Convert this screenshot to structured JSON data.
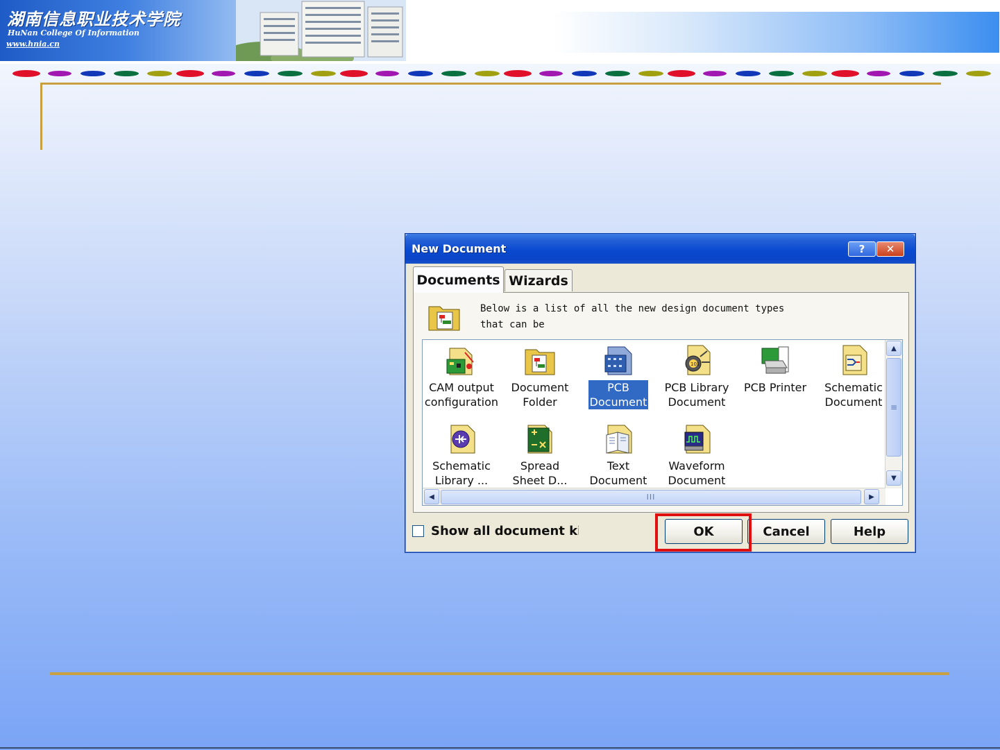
{
  "slide": {
    "logo_cn": "湖南信息职业技术学院",
    "logo_en": "HuNan  College  Of  Information",
    "logo_url": "www.hnia.cn"
  },
  "dialog": {
    "title": "New Document",
    "help_glyph": "?",
    "close_glyph": "✕",
    "tabs": [
      {
        "label": "Documents",
        "active": true
      },
      {
        "label": "Wizards",
        "active": false
      }
    ],
    "description": "Below is a list of all the new design document types\nthat can be",
    "documents": [
      {
        "label": "CAM output\nconfiguration",
        "icon": "cam-output-icon",
        "selected": false
      },
      {
        "label": "Document\nFolder",
        "icon": "document-folder-icon",
        "selected": false
      },
      {
        "label": "PCB\nDocument",
        "icon": "pcb-document-icon",
        "selected": true
      },
      {
        "label": "PCB Library\nDocument",
        "icon": "pcb-library-icon",
        "selected": false
      },
      {
        "label": "PCB Printer",
        "icon": "pcb-printer-icon",
        "selected": false
      },
      {
        "label": "Schematic\nDocument",
        "icon": "schematic-document-icon",
        "selected": false
      },
      {
        "label": "Schematic\nLibrary ...",
        "icon": "schematic-library-icon",
        "selected": false
      },
      {
        "label": "Spread\nSheet D...",
        "icon": "spreadsheet-icon",
        "selected": false
      },
      {
        "label": "Text\nDocument",
        "icon": "text-document-icon",
        "selected": false
      },
      {
        "label": "Waveform\nDocument",
        "icon": "waveform-document-icon",
        "selected": false
      }
    ],
    "scroll_up": "▲",
    "scroll_down": "▼",
    "scroll_left": "◀",
    "scroll_right": "▶",
    "vthumb_grip": "≡",
    "hthumb_grip": "III",
    "checkbox_label": "Show all document ki",
    "checkbox_checked": false,
    "buttons": {
      "ok": "OK",
      "cancel": "Cancel",
      "help": "Help"
    }
  },
  "colors": {
    "selection": "#316ac5",
    "titlebar": "#0a4ad0",
    "highlight_box": "#e01010",
    "frame_lines": "#c8a040"
  }
}
